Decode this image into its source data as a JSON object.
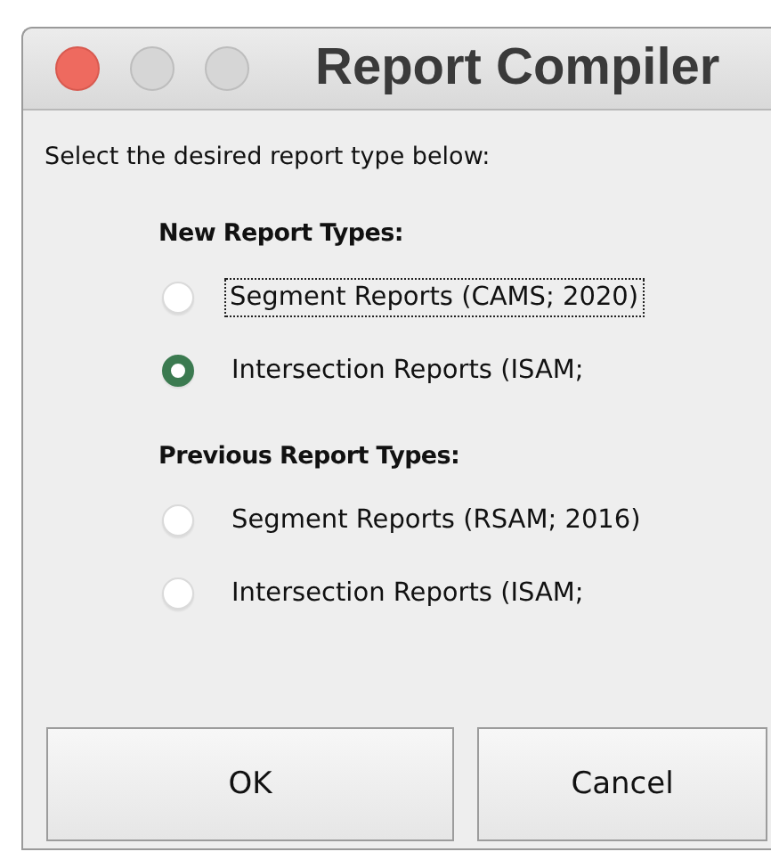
{
  "window": {
    "title": "Report Compiler"
  },
  "prompt": "Select the desired report type below:",
  "groups": [
    {
      "heading": "New Report Types:",
      "options": [
        {
          "label": "Segment Reports (CAMS; 2020)",
          "selected": false,
          "focused": true
        },
        {
          "label": "Intersection Reports (ISAM;",
          "selected": true,
          "focused": false
        }
      ]
    },
    {
      "heading": "Previous Report Types:",
      "options": [
        {
          "label": "Segment Reports (RSAM; 2016)",
          "selected": false,
          "focused": false
        },
        {
          "label": "Intersection Reports (ISAM;",
          "selected": false,
          "focused": false
        }
      ]
    }
  ],
  "buttons": [
    "OK",
    "Cancel"
  ]
}
